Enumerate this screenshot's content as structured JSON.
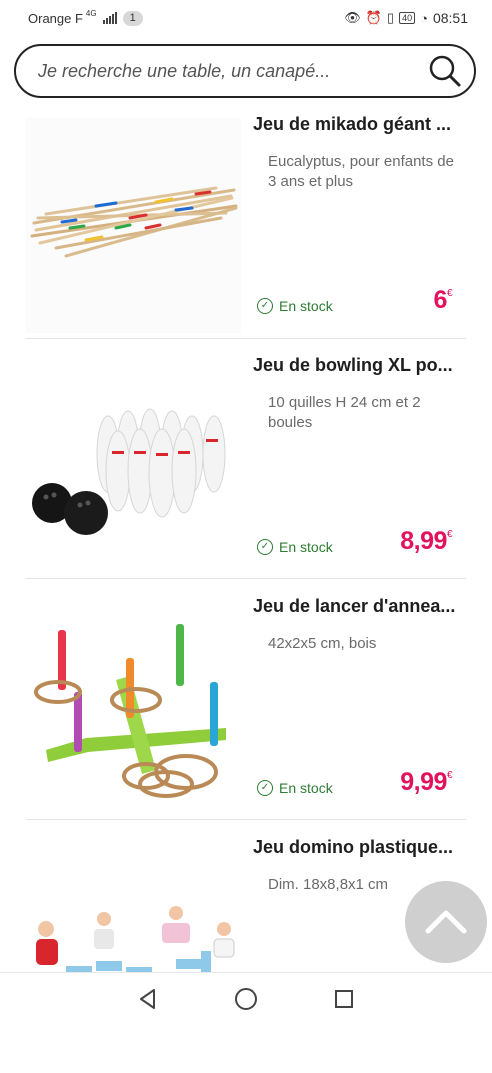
{
  "status_bar": {
    "carrier": "Orange F",
    "network": "4G",
    "notification_count": "1",
    "battery": "40",
    "time": "08:51"
  },
  "search": {
    "placeholder": "Je recherche une table, un canapé..."
  },
  "products": [
    {
      "title": "Jeu de mikado géant ...",
      "description": "Eucalyptus, pour enfants de 3 ans et plus",
      "stock": "En stock",
      "price": "6",
      "currency": "€"
    },
    {
      "title": "Jeu de bowling XL po...",
      "description": "10 quilles H 24 cm et 2 boules",
      "stock": "En stock",
      "price": "8,99",
      "currency": "€"
    },
    {
      "title": "Jeu de lancer d'annea...",
      "description": "42x2x5 cm, bois",
      "stock": "En stock",
      "price": "9,99",
      "currency": "€"
    },
    {
      "title": "Jeu domino plastique...",
      "description": "Dim. 18x8,8x1 cm",
      "stock": "",
      "price": "",
      "currency": ""
    }
  ],
  "colors": {
    "price": "#e2125d",
    "stock": "#2e7d32"
  },
  "icons": [
    "search-icon",
    "check-circle-icon",
    "chevron-up-icon",
    "back-icon",
    "home-icon",
    "recents-icon"
  ]
}
